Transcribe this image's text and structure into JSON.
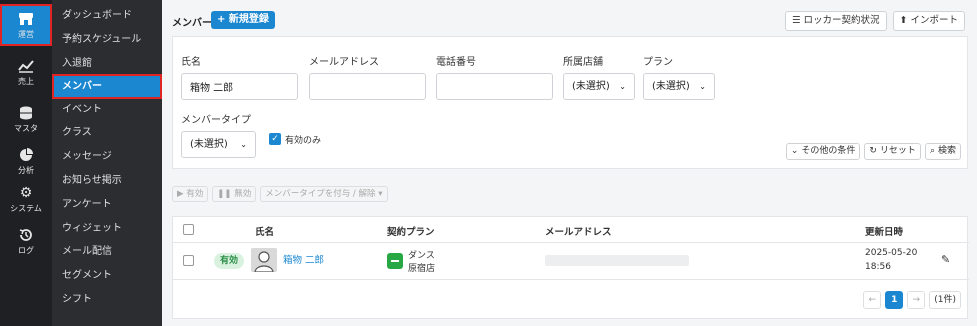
{
  "rail": [
    {
      "label": "運営",
      "icon": "store-icon"
    },
    {
      "label": "売上",
      "icon": "chart-line-icon"
    },
    {
      "label": "マスタ",
      "icon": "database-icon"
    },
    {
      "label": "分析",
      "icon": "pie-chart-icon"
    },
    {
      "label": "システム",
      "icon": "gear-icon"
    },
    {
      "label": "ログ",
      "icon": "history-icon"
    }
  ],
  "subnav": [
    "ダッシュボード",
    "予約スケジュール",
    "入退館",
    "メンバー",
    "イベント",
    "クラス",
    "メッセージ",
    "お知らせ掲示",
    "アンケート",
    "ウィジェット",
    "メール配信",
    "セグメント",
    "シフト"
  ],
  "header": {
    "title": "メンバー",
    "new_button": "+ 新規登録",
    "locker_button": "ロッカー契約状況",
    "import_button": "インポート"
  },
  "filter": {
    "name_label": "氏名",
    "name_value": "箱物 二郎",
    "email_label": "メールアドレス",
    "email_value": "",
    "phone_label": "電話番号",
    "phone_value": "",
    "shop_label": "所属店舗",
    "shop_value": "(未選択)",
    "plan_label": "プラン",
    "plan_value": "(未選択)",
    "type_label": "メンバータイプ",
    "type_value": "(未選択)",
    "active_only_label": "有効のみ",
    "more_button": "その他の条件",
    "reset_button": "リセット",
    "search_button": "検索"
  },
  "bulk": {
    "enable": "有効",
    "disable": "無効",
    "assign_type": "メンバータイプを付与 / 解除"
  },
  "table": {
    "headers": [
      "氏名",
      "契約プラン",
      "メールアドレス",
      "更新日時"
    ],
    "rows": [
      {
        "status": "有効",
        "name": "箱物 二郎",
        "plan": "ダンス",
        "shop": "原宿店",
        "email": "",
        "updated_date": "2025-05-20",
        "updated_time": "18:56"
      }
    ]
  },
  "pagination": {
    "prev": "←",
    "current": "1",
    "next": "→",
    "count": "(1件)"
  },
  "colors": {
    "accent": "#1a87d0",
    "highlight": "#e02424",
    "active_badge_bg": "#d9f2df",
    "active_badge_text": "#2a8f46",
    "plan_icon": "#28a745"
  }
}
